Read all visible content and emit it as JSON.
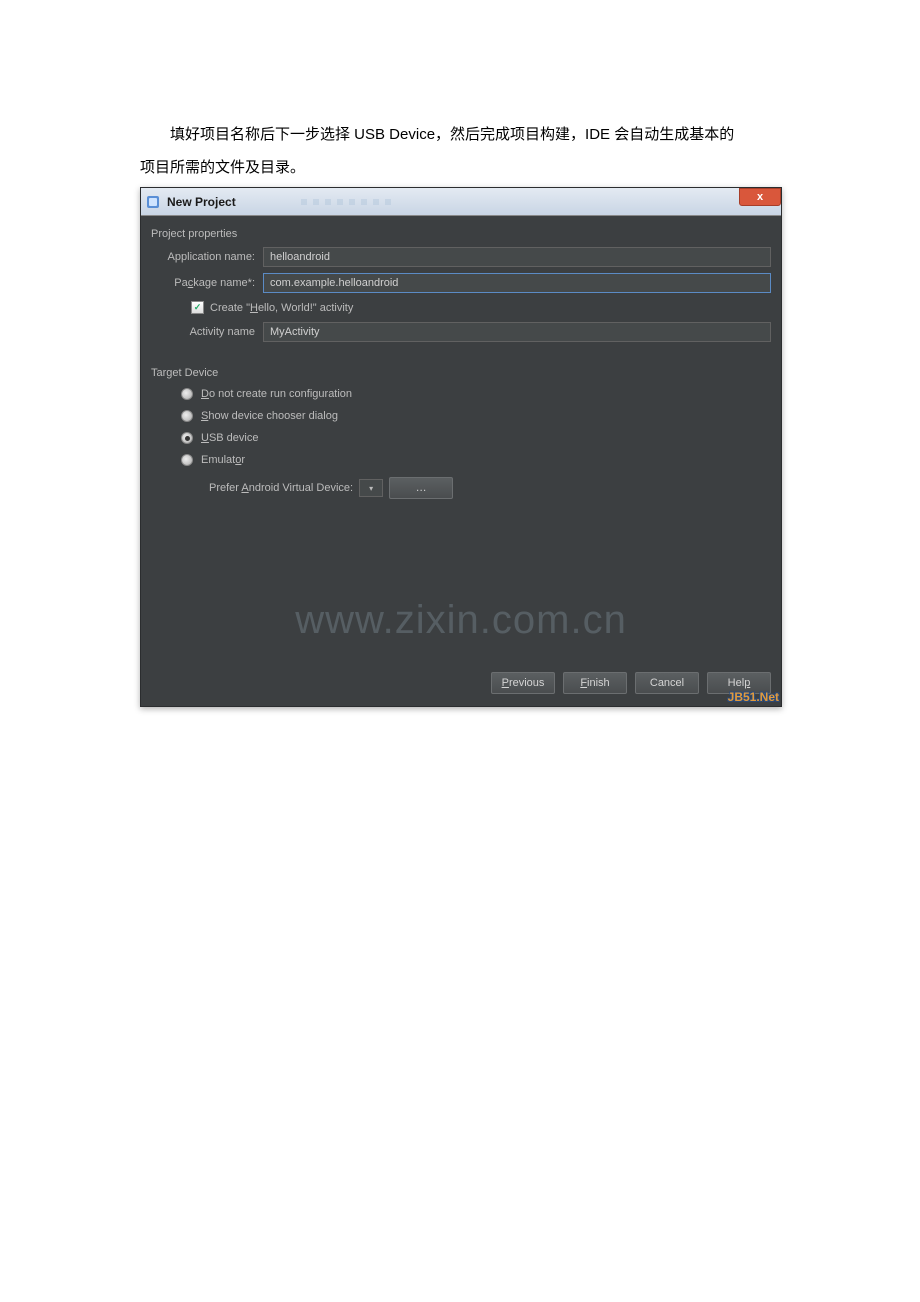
{
  "doc": {
    "line1_pre": "填好项目名称后下一步选择 ",
    "line1_bold": "USB Device",
    "line1_post": "，然后完成项目构建，IDE 会自动生成基本的",
    "line2": "项目所需的文件及目录。"
  },
  "dialog": {
    "title": "New Project",
    "close": "x",
    "sections": {
      "project_properties": "Project properties",
      "target_device": "Target Device"
    },
    "fields": {
      "app_name_label": "Application name:",
      "app_name_value": "helloandroid",
      "pkg_name_label": "Package name*:",
      "pkg_name_value": "com.example.helloandroid",
      "create_hello_label": "Create \"Hello, World!\" activity",
      "activity_name_label": "Activity name",
      "activity_name_value": "MyActivity"
    },
    "radios": {
      "no_run_config": "Do not create run configuration",
      "show_chooser": "Show device chooser dialog",
      "usb_device": "USB device",
      "emulator": "Emulator"
    },
    "avd_label": "Prefer Android Virtual Device:",
    "buttons": {
      "previous": "Previous",
      "finish": "Finish",
      "cancel": "Cancel",
      "help": "Help"
    }
  },
  "watermark": "www.zixin.com.cn",
  "badge": "JB51.Net"
}
